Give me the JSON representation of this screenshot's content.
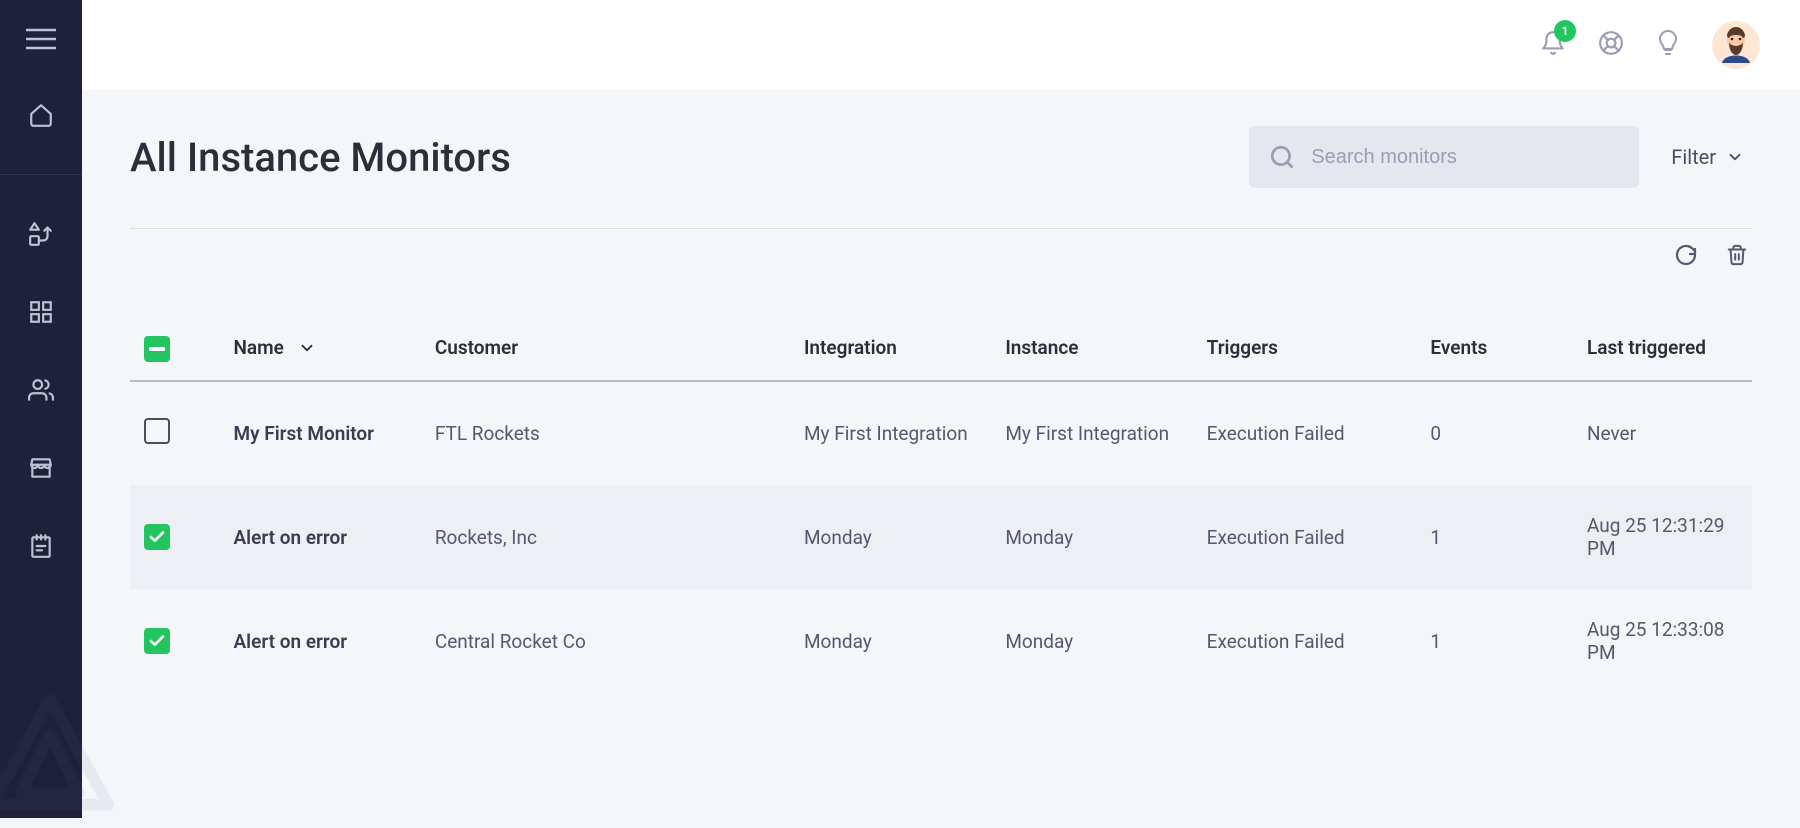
{
  "topbar": {
    "notification_count": "1"
  },
  "page": {
    "title": "All Instance Monitors"
  },
  "search": {
    "placeholder": "Search monitors",
    "value": ""
  },
  "filter": {
    "label": "Filter"
  },
  "table": {
    "headers": {
      "name": "Name",
      "customer": "Customer",
      "integration": "Integration",
      "instance": "Instance",
      "triggers": "Triggers",
      "events": "Events",
      "last_triggered": "Last triggered"
    },
    "rows": [
      {
        "checked": false,
        "name": "My First Monitor",
        "customer": "FTL Rockets",
        "integration": "My First Integration",
        "instance": "My First Integration",
        "triggers": "Execution Failed",
        "events": "0",
        "last_triggered": "Never"
      },
      {
        "checked": true,
        "name": "Alert on error",
        "customer": "Rockets, Inc",
        "integration": "Monday",
        "instance": "Monday",
        "triggers": "Execution Failed",
        "events": "1",
        "last_triggered": "Aug 25 12:31:29 PM"
      },
      {
        "checked": true,
        "name": "Alert on error",
        "customer": "Central Rocket Co",
        "integration": "Monday",
        "instance": "Monday",
        "triggers": "Execution Failed",
        "events": "1",
        "last_triggered": "Aug 25 12:33:08 PM"
      }
    ]
  }
}
